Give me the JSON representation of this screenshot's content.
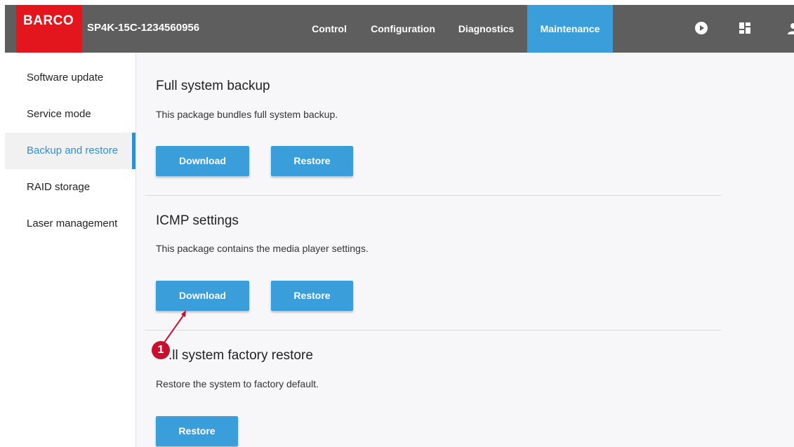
{
  "header": {
    "logo_text": "BARCO",
    "device_name": "SP4K-15C-1234560956",
    "tabs": [
      {
        "label": "Control"
      },
      {
        "label": "Configuration"
      },
      {
        "label": "Diagnostics"
      },
      {
        "label": "Maintenance",
        "active": true
      }
    ],
    "icons": [
      "play-icon",
      "dashboard-icon",
      "user-icon"
    ]
  },
  "sidebar": {
    "items": [
      {
        "label": "Software update"
      },
      {
        "label": "Service mode"
      },
      {
        "label": "Backup and restore",
        "active": true
      },
      {
        "label": "RAID storage"
      },
      {
        "label": "Laser management"
      }
    ]
  },
  "main": {
    "sections": [
      {
        "title": "Full system backup",
        "description": "This package bundles full system backup.",
        "download_label": "Download",
        "restore_label": "Restore"
      },
      {
        "title": "ICMP settings",
        "description": "This package contains the media player settings.",
        "download_label": "Download",
        "restore_label": "Restore"
      },
      {
        "title": ".ll system factory restore",
        "description": "Restore the system to factory default.",
        "restore_label": "Restore"
      }
    ]
  },
  "callout": {
    "number": "1",
    "color": "#c8102e"
  },
  "colors": {
    "header_bg": "#5e5e5e",
    "brand_red": "#e3161e",
    "accent_blue": "#3a9edb"
  }
}
